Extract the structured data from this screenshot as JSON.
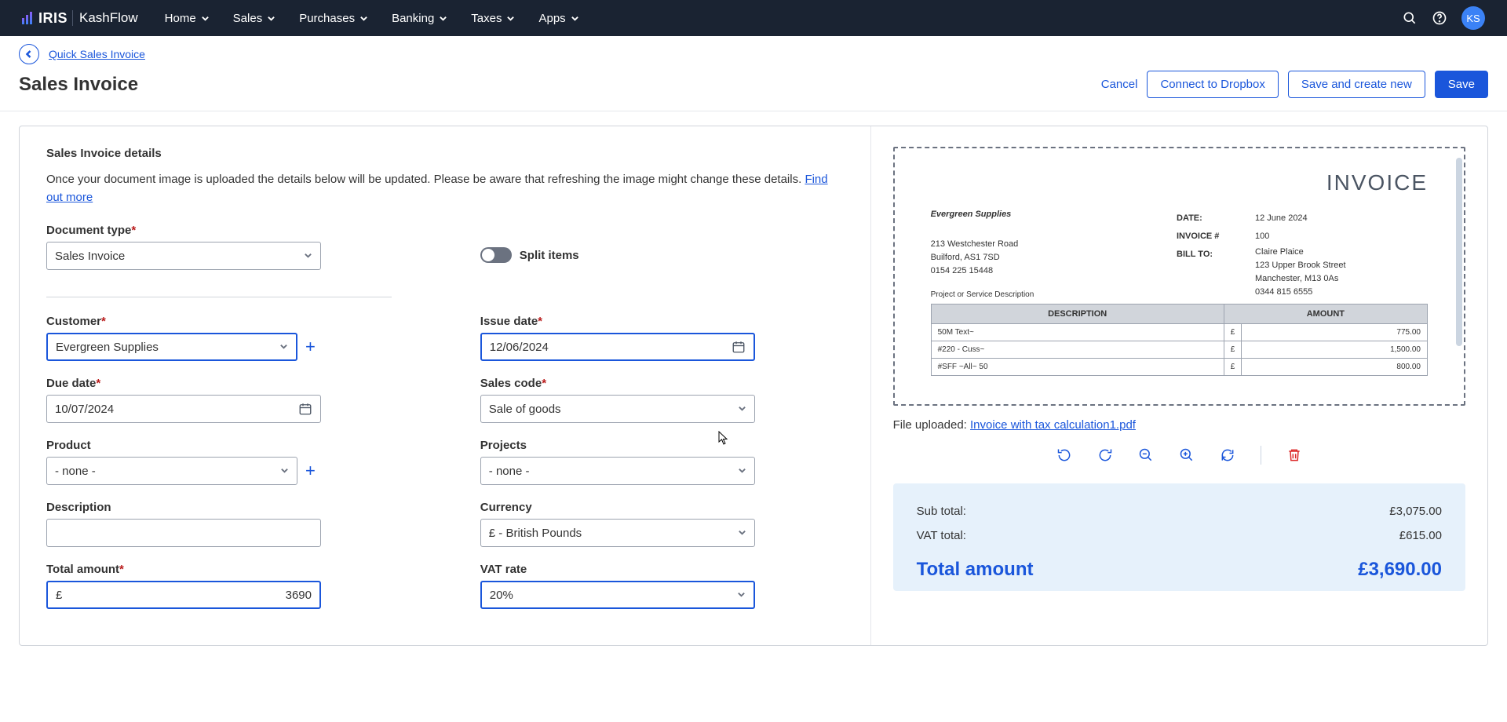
{
  "nav": {
    "brand_iris": "IRIS",
    "brand_kash": "KashFlow",
    "items": [
      "Home",
      "Sales",
      "Purchases",
      "Banking",
      "Taxes",
      "Apps"
    ],
    "avatar": "KS"
  },
  "breadcrumb": {
    "link": "Quick Sales Invoice"
  },
  "header": {
    "title": "Sales Invoice",
    "cancel": "Cancel",
    "dropbox": "Connect to Dropbox",
    "save_new": "Save and create new",
    "save": "Save"
  },
  "form": {
    "section_title": "Sales Invoice details",
    "help": "Once your document image is uploaded the details below will be updated. Please be aware that refreshing the image might change these details. ",
    "help_link": "Find out more",
    "doc_type_label": "Document type",
    "doc_type_value": "Sales Invoice",
    "split_label": "Split items",
    "customer_label": "Customer",
    "customer_value": "Evergreen Supplies",
    "issue_label": "Issue date",
    "issue_value": "12/06/2024",
    "due_label": "Due date",
    "due_value": "10/07/2024",
    "sales_code_label": "Sales code",
    "sales_code_value": "Sale of goods",
    "product_label": "Product",
    "product_value": "- none -",
    "projects_label": "Projects",
    "projects_value": "- none -",
    "desc_label": "Description",
    "desc_value": "",
    "currency_label": "Currency",
    "currency_value": "£ - British Pounds",
    "amount_label": "Total amount",
    "amount_symbol": "£",
    "amount_value": "3690",
    "vat_label": "VAT rate",
    "vat_value": "20%"
  },
  "preview": {
    "title": "INVOICE",
    "company": "Evergreen Supplies",
    "addr": [
      "213 Westchester Road",
      "Builford, AS1 7SD",
      "0154 225 15448"
    ],
    "date_lbl": "DATE:",
    "date_val": "12 June 2024",
    "num_lbl": "INVOICE #",
    "num_val": "100",
    "bill_lbl": "BILL TO:",
    "bill_to": [
      "Claire Plaice",
      "123 Upper Brook Street",
      "Manchester, M13 0As",
      "0344 815 6555"
    ],
    "svc_lbl": "Project or Service Description",
    "th_desc": "DESCRIPTION",
    "th_amt": "AMOUNT",
    "rows": [
      {
        "d": "50M Text~",
        "c": "£",
        "a": "775.00"
      },
      {
        "d": "#220 - Cuss~",
        "c": "£",
        "a": "1,500.00"
      },
      {
        "d": "#SFF ~All~ 50",
        "c": "£",
        "a": "800.00"
      }
    ],
    "file_label": "File uploaded: ",
    "file_name": "Invoice with tax calculation1.pdf"
  },
  "totals": {
    "sub_lbl": "Sub total:",
    "sub_val": "£3,075.00",
    "vat_lbl": "VAT total:",
    "vat_val": "£615.00",
    "tot_lbl": "Total amount",
    "tot_val": "£3,690.00"
  }
}
